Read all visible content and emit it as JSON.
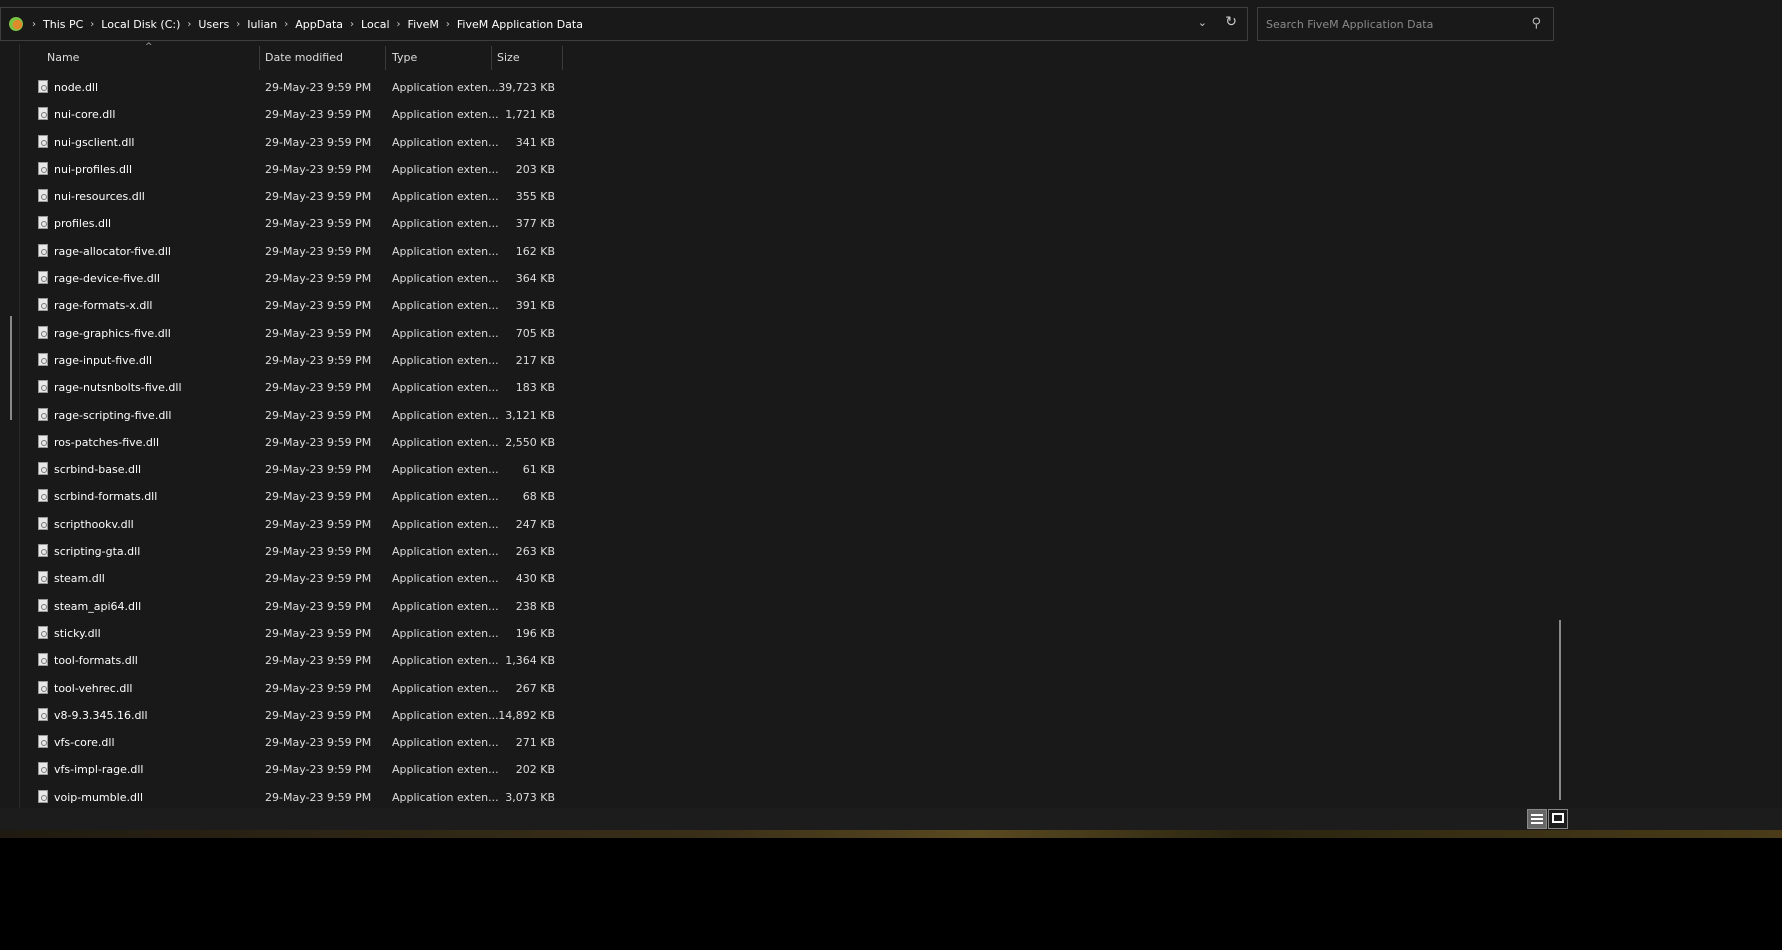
{
  "breadcrumb": [
    "This PC",
    "Local Disk (C:)",
    "Users",
    "Iulian",
    "AppData",
    "Local",
    "FiveM",
    "FiveM Application Data"
  ],
  "search": {
    "placeholder": "Search FiveM Application Data"
  },
  "columns": {
    "name": "Name",
    "date": "Date modified",
    "type": "Type",
    "size": "Size"
  },
  "files": [
    {
      "name": "node.dll",
      "date": "29-May-23 9:59 PM",
      "type": "Application exten...",
      "size": "39,723 KB"
    },
    {
      "name": "nui-core.dll",
      "date": "29-May-23 9:59 PM",
      "type": "Application exten...",
      "size": "1,721 KB"
    },
    {
      "name": "nui-gsclient.dll",
      "date": "29-May-23 9:59 PM",
      "type": "Application exten...",
      "size": "341 KB"
    },
    {
      "name": "nui-profiles.dll",
      "date": "29-May-23 9:59 PM",
      "type": "Application exten...",
      "size": "203 KB"
    },
    {
      "name": "nui-resources.dll",
      "date": "29-May-23 9:59 PM",
      "type": "Application exten...",
      "size": "355 KB"
    },
    {
      "name": "profiles.dll",
      "date": "29-May-23 9:59 PM",
      "type": "Application exten...",
      "size": "377 KB"
    },
    {
      "name": "rage-allocator-five.dll",
      "date": "29-May-23 9:59 PM",
      "type": "Application exten...",
      "size": "162 KB"
    },
    {
      "name": "rage-device-five.dll",
      "date": "29-May-23 9:59 PM",
      "type": "Application exten...",
      "size": "364 KB"
    },
    {
      "name": "rage-formats-x.dll",
      "date": "29-May-23 9:59 PM",
      "type": "Application exten...",
      "size": "391 KB"
    },
    {
      "name": "rage-graphics-five.dll",
      "date": "29-May-23 9:59 PM",
      "type": "Application exten...",
      "size": "705 KB"
    },
    {
      "name": "rage-input-five.dll",
      "date": "29-May-23 9:59 PM",
      "type": "Application exten...",
      "size": "217 KB"
    },
    {
      "name": "rage-nutsnbolts-five.dll",
      "date": "29-May-23 9:59 PM",
      "type": "Application exten...",
      "size": "183 KB"
    },
    {
      "name": "rage-scripting-five.dll",
      "date": "29-May-23 9:59 PM",
      "type": "Application exten...",
      "size": "3,121 KB"
    },
    {
      "name": "ros-patches-five.dll",
      "date": "29-May-23 9:59 PM",
      "type": "Application exten...",
      "size": "2,550 KB"
    },
    {
      "name": "scrbind-base.dll",
      "date": "29-May-23 9:59 PM",
      "type": "Application exten...",
      "size": "61 KB"
    },
    {
      "name": "scrbind-formats.dll",
      "date": "29-May-23 9:59 PM",
      "type": "Application exten...",
      "size": "68 KB"
    },
    {
      "name": "scripthookv.dll",
      "date": "29-May-23 9:59 PM",
      "type": "Application exten...",
      "size": "247 KB"
    },
    {
      "name": "scripting-gta.dll",
      "date": "29-May-23 9:59 PM",
      "type": "Application exten...",
      "size": "263 KB"
    },
    {
      "name": "steam.dll",
      "date": "29-May-23 9:59 PM",
      "type": "Application exten...",
      "size": "430 KB"
    },
    {
      "name": "steam_api64.dll",
      "date": "29-May-23 9:59 PM",
      "type": "Application exten...",
      "size": "238 KB"
    },
    {
      "name": "sticky.dll",
      "date": "29-May-23 9:59 PM",
      "type": "Application exten...",
      "size": "196 KB"
    },
    {
      "name": "tool-formats.dll",
      "date": "29-May-23 9:59 PM",
      "type": "Application exten...",
      "size": "1,364 KB"
    },
    {
      "name": "tool-vehrec.dll",
      "date": "29-May-23 9:59 PM",
      "type": "Application exten...",
      "size": "267 KB"
    },
    {
      "name": "v8-9.3.345.16.dll",
      "date": "29-May-23 9:59 PM",
      "type": "Application exten...",
      "size": "14,892 KB"
    },
    {
      "name": "vfs-core.dll",
      "date": "29-May-23 9:59 PM",
      "type": "Application exten...",
      "size": "271 KB"
    },
    {
      "name": "vfs-impl-rage.dll",
      "date": "29-May-23 9:59 PM",
      "type": "Application exten...",
      "size": "202 KB"
    },
    {
      "name": "voip-mumble.dll",
      "date": "29-May-23 9:59 PM",
      "type": "Application exten...",
      "size": "3,073 KB"
    }
  ]
}
